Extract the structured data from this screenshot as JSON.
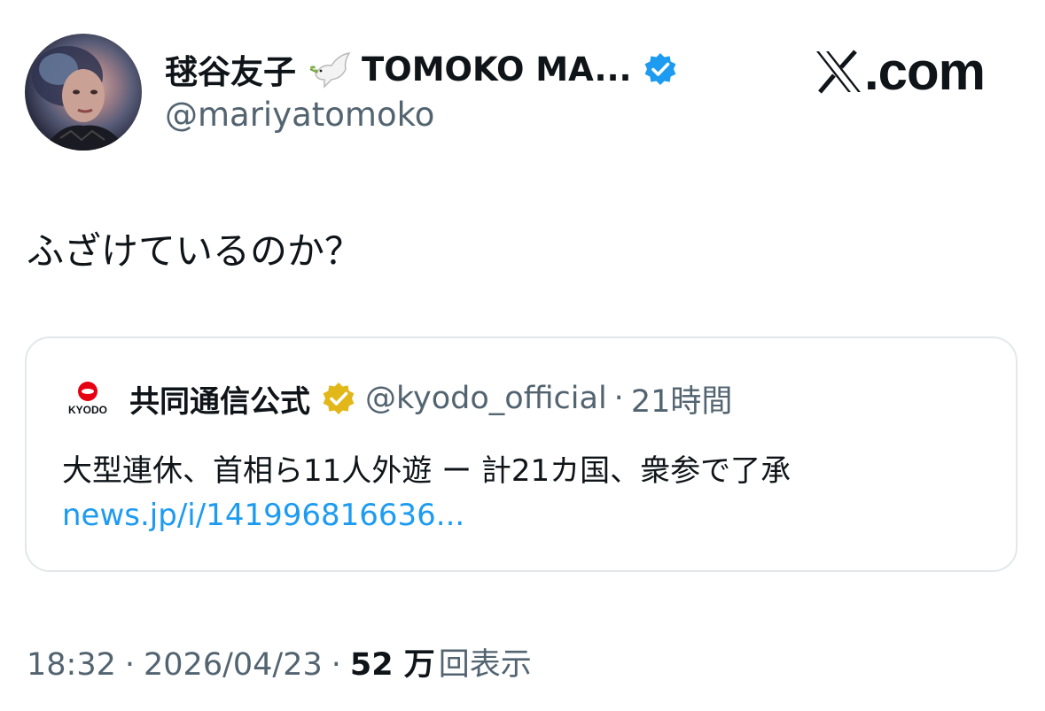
{
  "author": {
    "display_name": "毬谷友子",
    "display_name_suffix": "TOMOKO MA...",
    "handle": "@mariyatomoko",
    "emoji": "dove-icon",
    "verified_color": "#1d9bf0"
  },
  "brand": {
    "text": ".com"
  },
  "tweet": {
    "text": "ふざけているのか？"
  },
  "quote": {
    "logo_text": "KYODO",
    "logo_color": "#e60012",
    "name": "共同通信公式",
    "badge_color": "#e2b719",
    "handle": "@kyodo_official",
    "separator": "·",
    "time": "21時間",
    "text": "大型連休、首相ら11人外遊 ー 計21カ国、衆参で了承",
    "link": "news.jp/i/141996816636..."
  },
  "meta": {
    "time": "18:32",
    "separator": "·",
    "date": "2026/04/23",
    "views_count": "52 万",
    "views_label": "回表示"
  }
}
